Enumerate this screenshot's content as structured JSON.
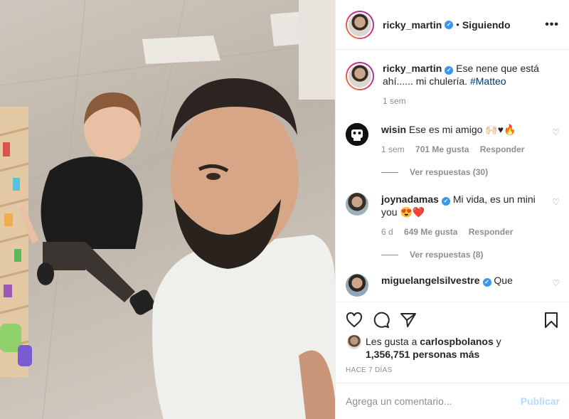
{
  "post": {
    "author": "ricky_martin",
    "following_label": "Siguiendo",
    "more_label": "•••"
  },
  "caption": {
    "author": "ricky_martin",
    "text": "Ese nene que está ahí...... mi chulería.",
    "hashtag": "#Matteo",
    "time": "1 sem"
  },
  "comments": [
    {
      "author": "wisin",
      "text": "Ese es mi amigo 🙌🏻♥🔥",
      "time": "1 sem",
      "likes": "701 Me gusta",
      "reply_label": "Responder",
      "view_replies": "Ver respuestas (30)"
    },
    {
      "author": "joynadamas",
      "text": "Mi vida, es un mini you 😍❤️",
      "time": "6 d",
      "likes": "649 Me gusta",
      "reply_label": "Responder",
      "view_replies": "Ver respuestas (8)"
    },
    {
      "author": "miguelangelsilvestre",
      "text": "Que"
    }
  ],
  "likes": {
    "prefix": "Les gusta a ",
    "user": "carlospbolanos",
    "mid": " y",
    "count": "1,356,751 personas más"
  },
  "date": "HACE 7 DÍAS",
  "add_comment": {
    "placeholder": "Agrega un comentario...",
    "publish": "Publicar"
  },
  "icons": {
    "like": "heart-icon",
    "comment": "comment-icon",
    "share": "share-icon",
    "save": "bookmark-icon"
  },
  "colors": {
    "verified": "#3897f0",
    "link": "#00376b",
    "muted": "#8e8e8e",
    "publish_disabled": "#b3dbff"
  }
}
